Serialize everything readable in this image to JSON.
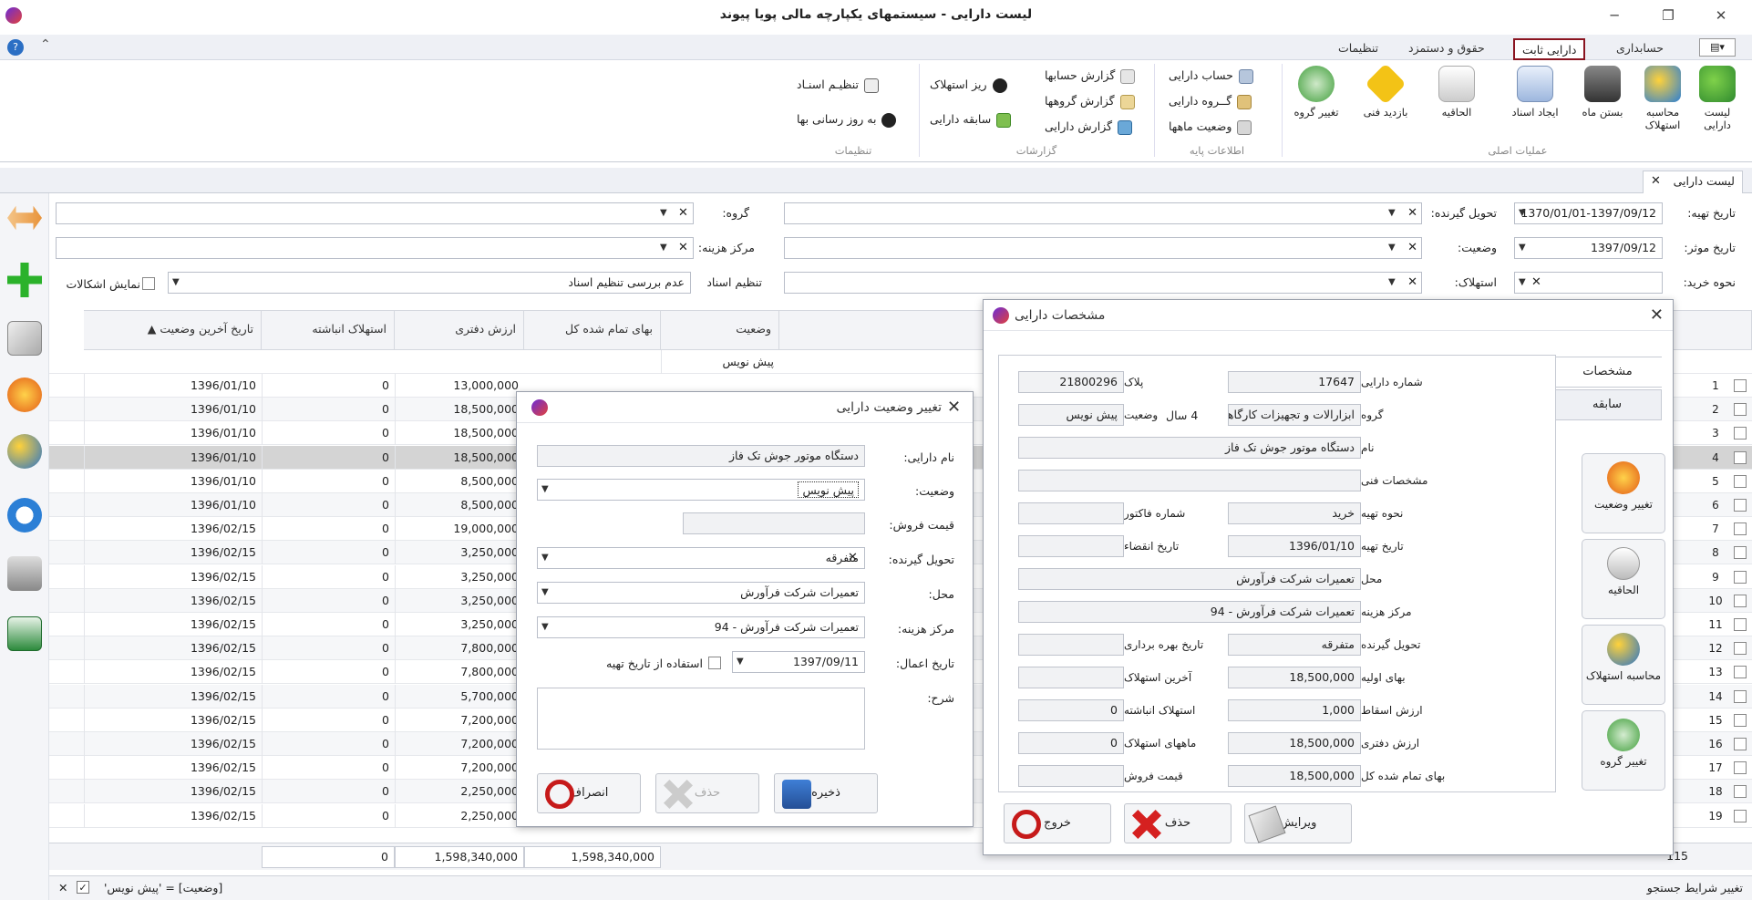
{
  "window": {
    "title": "لیست دارایی - سیستمهای یکپارچه مالی پویا پیوند"
  },
  "menu": {
    "tabs": [
      "حسابداری",
      "دارایی ثابت",
      "حقوق و دستمزد",
      "تنظیمات"
    ],
    "active": "دارایی ثابت"
  },
  "ribbon": {
    "main_ops": {
      "label": "عملیات اصلی",
      "buttons": [
        "لیست دارایی",
        "محاسبه استهلاک",
        "بستن ماه",
        "ایجاد اسناد",
        "الحاقیه",
        "بازدید فنی",
        "تغییر گروه"
      ]
    },
    "base_info": {
      "label": "اطلاعات پایه",
      "buttons": [
        "حساب دارایی",
        "گــروه دارایی",
        "وضعیت ماهها"
      ]
    },
    "reports": {
      "label": "گزارشات",
      "buttons": [
        "گزارش حسابها",
        "گزارش گروهها",
        "گزارش دارایی",
        "ریز استهلاک",
        "سابقه دارایی"
      ]
    },
    "settings": {
      "label": "تنظیمات",
      "buttons": [
        "تنظیـم اسنـاد",
        "به روز رسانی بها"
      ]
    }
  },
  "doc_tab": "لیست دارایی",
  "filters": {
    "prep_date_label": "تاریخ تهیه:",
    "prep_date_value": "1370/01/01-1397/09/12",
    "effective_date_label": "تاریخ موثر:",
    "effective_date_value": "1397/09/12",
    "purchase_label": "نحوه خرید:",
    "receiver_label": "تحویل گیرنده:",
    "status_label": "وضعیت:",
    "depreciation_label": "استهلاک:",
    "group_label": "گروه:",
    "cost_center_label": "مرکز هزینه:",
    "doc_setting_label": "تنظیم اسناد",
    "doc_setting_value": "عدم بررسی تنظیم اسناد",
    "show_problems_label": "نمایش اشکالات"
  },
  "grid": {
    "columns": [
      "وضعیت",
      "بهای تمام شده کل",
      "ارزش دفتری",
      "استهلاک انباشته",
      "تاریخ آخرین وضعیت"
    ],
    "filter_row_status": "پیش نویس",
    "rows": [
      {
        "n": "1",
        "book": "13,000,000",
        "acc": "0",
        "date": "1396/01/10"
      },
      {
        "n": "2",
        "book": "18,500,000",
        "acc": "0",
        "date": "1396/01/10"
      },
      {
        "n": "3",
        "book": "18,500,000",
        "acc": "0",
        "date": "1396/01/10"
      },
      {
        "n": "4",
        "book": "18,500,000",
        "acc": "0",
        "date": "1396/01/10"
      },
      {
        "n": "5",
        "book": "8,500,000",
        "acc": "0",
        "date": "1396/01/10"
      },
      {
        "n": "6",
        "book": "8,500,000",
        "acc": "0",
        "date": "1396/01/10"
      },
      {
        "n": "7",
        "book": "19,000,000",
        "acc": "0",
        "date": "1396/02/15"
      },
      {
        "n": "8",
        "book": "3,250,000",
        "acc": "0",
        "date": "1396/02/15"
      },
      {
        "n": "9",
        "book": "3,250,000",
        "acc": "0",
        "date": "1396/02/15"
      },
      {
        "n": "10",
        "book": "3,250,000",
        "acc": "0",
        "date": "1396/02/15"
      },
      {
        "n": "11",
        "book": "3,250,000",
        "acc": "0",
        "date": "1396/02/15"
      },
      {
        "n": "12",
        "book": "7,800,000",
        "acc": "0",
        "date": "1396/02/15"
      },
      {
        "n": "13",
        "book": "7,800,000",
        "acc": "0",
        "date": "1396/02/15"
      },
      {
        "n": "14",
        "book": "5,700,000",
        "acc": "0",
        "date": "1396/02/15"
      },
      {
        "n": "15",
        "book": "7,200,000",
        "acc": "0",
        "date": "1396/02/15"
      },
      {
        "n": "16",
        "book": "7,200,000",
        "acc": "0",
        "date": "1396/02/15"
      },
      {
        "n": "17",
        "book": "7,200,000",
        "acc": "0",
        "date": "1396/02/15"
      },
      {
        "n": "18",
        "book": "2,250,000",
        "acc": "0",
        "date": "1396/02/15"
      },
      {
        "n": "19",
        "book": "2,250,000",
        "acc": "0",
        "date": "1396/02/15"
      }
    ],
    "footer": {
      "count": "115",
      "total_cost": "1,598,340,000",
      "book_total": "1,598,340,000",
      "acc_total": "0"
    },
    "status_filter": "[وضعیت] = 'پیش نویس'",
    "edit_filter_label": "تغییر شرایط جستجو"
  },
  "status_dialog": {
    "title": "تغییر وضعیت دارایی",
    "name_label": "نام دارایی:",
    "name_value": "دستگاه موتور جوش تک فاز",
    "status_label": "وضعیت:",
    "status_value": "پیش نویس",
    "sale_price_label": "قیمت فروش:",
    "receiver_label": "تحویل گیرنده:",
    "receiver_value": "متفرقه",
    "location_label": "محل:",
    "location_value": "تعمیرات شرکت فرآورش",
    "cost_center_label": "مرکز هزینه:",
    "cost_center_value": "تعمیرات شرکت فرآورش - 94",
    "apply_date_label": "تاریخ اعمال:",
    "apply_date_value": "1397/09/11",
    "use_prep_date_label": "استفاده از تاریخ تهیه",
    "desc_label": "شرح:",
    "save": "ذخیره",
    "delete": "حذف",
    "cancel": "انصراف"
  },
  "asset_dialog": {
    "title": "مشخصات دارایی",
    "tabs": [
      "مشخصات",
      "سابقه"
    ],
    "asset_no_label": "شماره دارایی:",
    "asset_no": "17647",
    "plate_label": "پلاک:",
    "plate": "21800296",
    "group_label": "گروه:",
    "group": "ابزارالات و تجهیزات کارگاهی",
    "group_years": "4 سال",
    "status_label": "وضعیت:",
    "status": "پیش نویس",
    "name_label": "نام:",
    "name": "دستگاه موتور جوش تک فاز",
    "tech_label": "مشخصات فنی:",
    "prep_method_label": "نحوه تهیه:",
    "prep_method": "خرید",
    "invoice_label": "شماره فاکتور:",
    "prep_date_label": "تاریخ تهیه:",
    "prep_date": "1396/01/10",
    "expire_label": "تاریخ انقضاء:",
    "location_label": "محل:",
    "location": "تعمیرات شرکت فرآورش",
    "cost_center_label": "مرکز هزینه:",
    "cost_center": "تعمیرات شرکت فرآورش - 94",
    "receiver_label": "تحویل گیرنده:",
    "receiver": "متفرقه",
    "use_date_label": "تاریخ بهره برداری:",
    "initial_label": "بهای اولیه:",
    "initial": "18,500,000",
    "last_dep_label": "آخرین استهلاک:",
    "salvage_label": "ارزش اسقاط:",
    "salvage": "1,000",
    "acc_dep_label": "استهلاک انباشته:",
    "acc_dep": "0",
    "book_label": "ارزش دفتری:",
    "book": "18,500,000",
    "dep_months_label": "ماههای استهلاک:",
    "dep_months": "0",
    "total_cost_label": "بهای تمام شده کل:",
    "total_cost": "18,500,000",
    "sale_price_label": "قیمت فروش:",
    "side_buttons": [
      "تغییر وضعیت",
      "الحاقیه",
      "محاسبه استهلاک",
      "تغییر گروه"
    ],
    "edit": "ویرایش",
    "delete": "حذف",
    "exit": "خروج"
  }
}
